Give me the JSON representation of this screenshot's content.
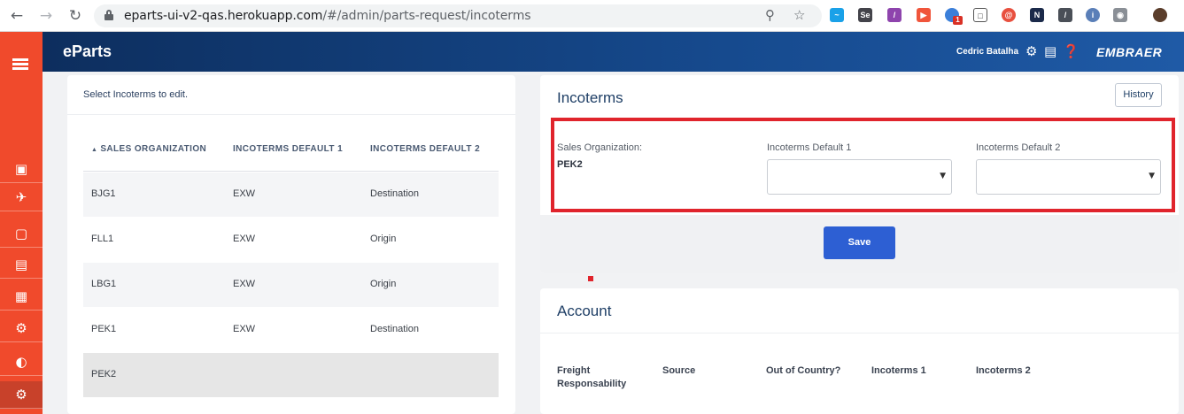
{
  "browser": {
    "url_host": "eparts-ui-v2-qas.herokuapp.com",
    "url_path": "/#/admin/parts-request/incoterms",
    "extension_badge": "1"
  },
  "app": {
    "brand": "eParts",
    "user_name": "Cedric Batalha",
    "logo_text": "EMBRAER"
  },
  "incoterms_list": {
    "hint": "Select Incoterms to edit.",
    "columns": [
      "SALES ORGANIZATION",
      "INCOTERMS DEFAULT 1",
      "INCOTERMS DEFAULT 2"
    ],
    "rows": [
      {
        "org": "BJG1",
        "d1": "EXW",
        "d2": "Destination"
      },
      {
        "org": "FLL1",
        "d1": "EXW",
        "d2": "Origin"
      },
      {
        "org": "LBG1",
        "d1": "EXW",
        "d2": "Origin"
      },
      {
        "org": "PEK1",
        "d1": "EXW",
        "d2": "Destination"
      },
      {
        "org": "PEK2",
        "d1": "",
        "d2": ""
      }
    ]
  },
  "incoterms_form": {
    "title": "Incoterms",
    "history_label": "History",
    "sales_org_label": "Sales Organization:",
    "sales_org_value": "PEK2",
    "default1_label": "Incoterms Default 1",
    "default1_value": "",
    "default2_label": "Incoterms Default 2",
    "default2_value": "",
    "save_label": "Save"
  },
  "account": {
    "title": "Account",
    "col_freight_1": "Freight",
    "col_freight_2": "Responsability",
    "col_source": "Source",
    "col_out_of_country": "Out of Country?",
    "col_incoterms1": "Incoterms 1",
    "col_incoterms2": "Incoterms 2"
  },
  "colors": {
    "rail": "#f04a2c",
    "topbar": "#164a8e",
    "highlight": "#e0242c",
    "primary_button": "#2d5fd3"
  }
}
